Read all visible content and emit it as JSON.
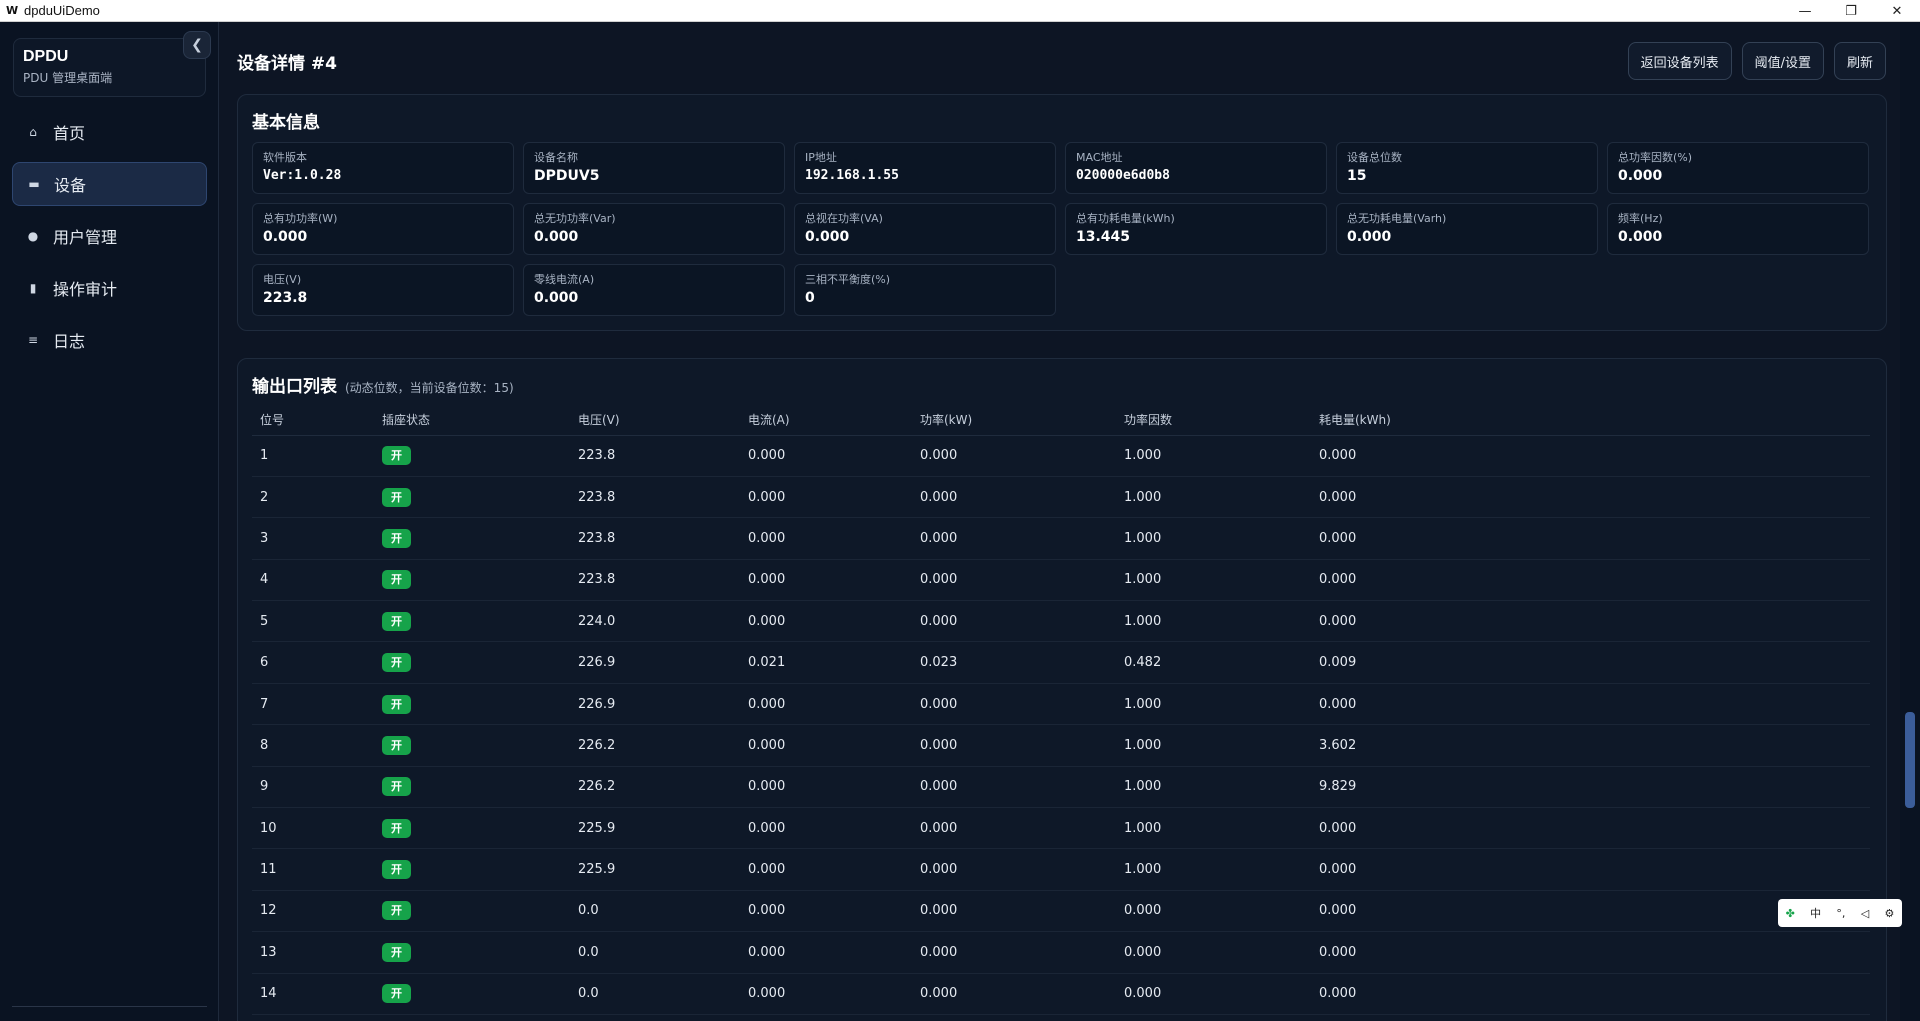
{
  "window": {
    "title": "dpduUiDemo",
    "controls": [
      "—",
      "❐",
      "✕"
    ]
  },
  "brand": {
    "name": "DPDU",
    "subtitle": "PDU 管理桌面端",
    "collapse_icon": "❮"
  },
  "nav": {
    "items": [
      {
        "label": "首页",
        "icon": "home-icon",
        "glyph": "⌂"
      },
      {
        "label": "设备",
        "icon": "device-icon",
        "glyph": "▬"
      },
      {
        "label": "用户管理",
        "icon": "user-icon",
        "glyph": "●"
      },
      {
        "label": "操作审计",
        "icon": "document-icon",
        "glyph": "▮"
      },
      {
        "label": "日志",
        "icon": "list-icon",
        "glyph": "≡"
      }
    ],
    "active_index": 1
  },
  "page": {
    "title": "设备详情 #4",
    "actions": {
      "back": "返回设备列表",
      "threshold": "阈值/设置",
      "refresh": "刷新"
    }
  },
  "basic_info": {
    "title": "基本信息",
    "fields": [
      {
        "label": "软件版本",
        "value": "Ver:1.0.28",
        "mono": true
      },
      {
        "label": "设备名称",
        "value": "DPDUV5"
      },
      {
        "label": "IP地址",
        "value": "192.168.1.55",
        "mono": true
      },
      {
        "label": "MAC地址",
        "value": "020000e6d0b8",
        "mono": true
      },
      {
        "label": "设备总位数",
        "value": "15"
      },
      {
        "label": "总功率因数(%)",
        "value": "0.000"
      },
      {
        "label": "总有功功率(W)",
        "value": "0.000"
      },
      {
        "label": "总无功功率(Var)",
        "value": "0.000"
      },
      {
        "label": "总视在功率(VA)",
        "value": "0.000"
      },
      {
        "label": "总有功耗电量(kWh)",
        "value": "13.445"
      },
      {
        "label": "总无功耗电量(Varh)",
        "value": "0.000"
      },
      {
        "label": "频率(Hz)",
        "value": "0.000"
      },
      {
        "label": "电压(V)",
        "value": "223.8"
      },
      {
        "label": "零线电流(A)",
        "value": "0.000"
      },
      {
        "label": "三相不平衡度(%)",
        "value": "0"
      }
    ]
  },
  "outputs": {
    "title": "输出口列表",
    "note": "(动态位数，当前设备位数：15)",
    "columns": [
      "位号",
      "插座状态",
      "电压(V)",
      "电流(A)",
      "功率(kW)",
      "功率因数",
      "耗电量(kWh)"
    ],
    "rows": [
      [
        "1",
        "开",
        "223.8",
        "0.000",
        "0.000",
        "1.000",
        "0.000"
      ],
      [
        "2",
        "开",
        "223.8",
        "0.000",
        "0.000",
        "1.000",
        "0.000"
      ],
      [
        "3",
        "开",
        "223.8",
        "0.000",
        "0.000",
        "1.000",
        "0.000"
      ],
      [
        "4",
        "开",
        "223.8",
        "0.000",
        "0.000",
        "1.000",
        "0.000"
      ],
      [
        "5",
        "开",
        "224.0",
        "0.000",
        "0.000",
        "1.000",
        "0.000"
      ],
      [
        "6",
        "开",
        "226.9",
        "0.021",
        "0.023",
        "0.482",
        "0.009"
      ],
      [
        "7",
        "开",
        "226.9",
        "0.000",
        "0.000",
        "1.000",
        "0.000"
      ],
      [
        "8",
        "开",
        "226.2",
        "0.000",
        "0.000",
        "1.000",
        "3.602"
      ],
      [
        "9",
        "开",
        "226.2",
        "0.000",
        "0.000",
        "1.000",
        "9.829"
      ],
      [
        "10",
        "开",
        "225.9",
        "0.000",
        "0.000",
        "1.000",
        "0.000"
      ],
      [
        "11",
        "开",
        "225.9",
        "0.000",
        "0.000",
        "1.000",
        "0.000"
      ],
      [
        "12",
        "开",
        "0.0",
        "0.000",
        "0.000",
        "0.000",
        "0.000"
      ],
      [
        "13",
        "开",
        "0.0",
        "0.000",
        "0.000",
        "0.000",
        "0.000"
      ],
      [
        "14",
        "开",
        "0.0",
        "0.000",
        "0.000",
        "0.000",
        "0.000"
      ]
    ]
  },
  "ime": {
    "items": [
      "中",
      "°,",
      "◁",
      "⚙"
    ]
  },
  "colors": {
    "accent": "#16a34a",
    "background": "#0d1524",
    "active_nav": "#1b2a45"
  }
}
